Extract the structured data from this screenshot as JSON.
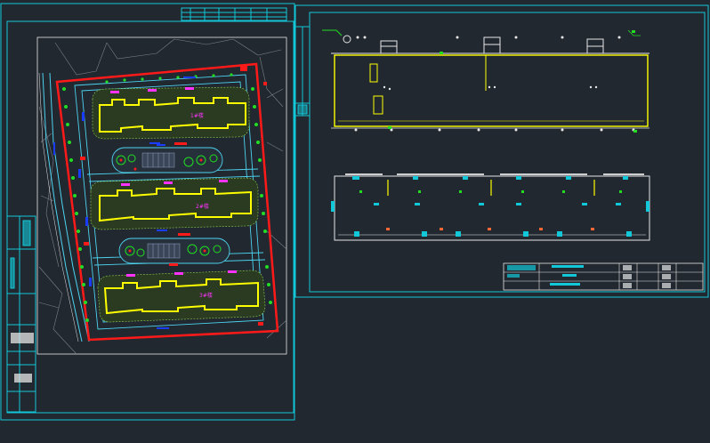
{
  "drawing": {
    "background": "#212830",
    "frame_color": "#12c8d8",
    "boundary_color": "#ff1a1a",
    "building_color": "#ffff00",
    "label_color": "#ff33ff",
    "road_color": "#4dd2ee",
    "dim_color": "#1a3cff",
    "tree_color": "#22dd22",
    "white_line": "#e6e6e6"
  },
  "site_plan": {
    "blocks": [
      {
        "label": "1#楼"
      },
      {
        "label": "2#楼"
      },
      {
        "label": "3#楼"
      }
    ]
  },
  "elevations": {
    "top_view": {},
    "bottom_view": {}
  },
  "title_block": {}
}
